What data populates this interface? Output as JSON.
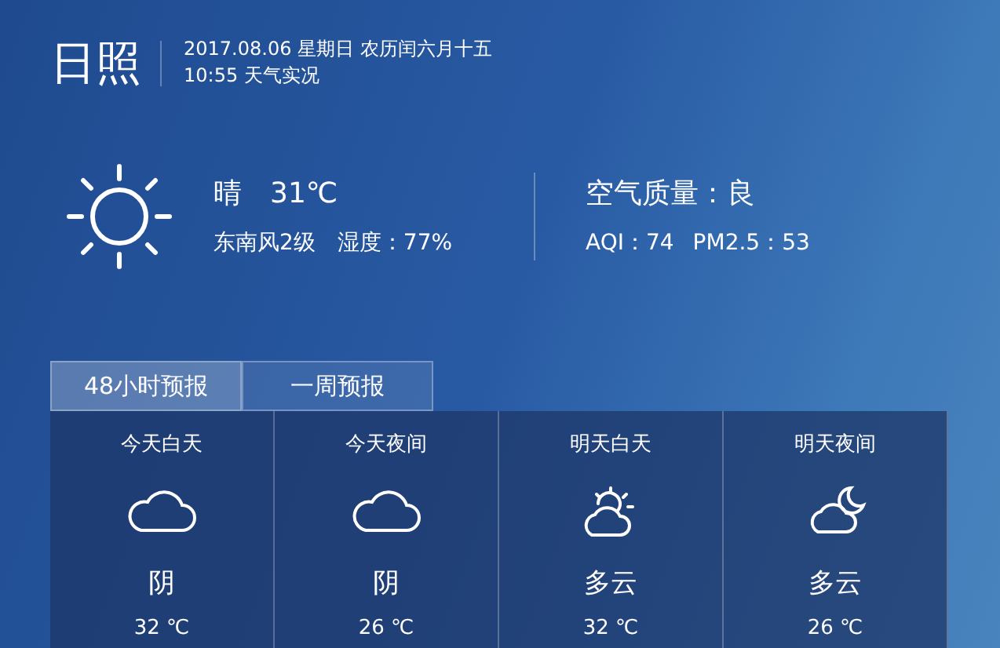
{
  "header": {
    "city": "日照",
    "date": "2017.08.06 星期日 农历闰六月十五",
    "time": "10:55 天气实况"
  },
  "current": {
    "kind": "sun",
    "condition": "晴",
    "temperature": "31℃",
    "wind": "东南风2级",
    "humidity": "湿度：77%",
    "air_quality": "空气质量：良",
    "aqi": "AQI：74",
    "pm25": "PM2.5：53"
  },
  "tabs": [
    {
      "label": "48小时预报",
      "selected": true
    },
    {
      "label": "一周预报",
      "selected": false
    }
  ],
  "forecast": [
    {
      "period": "今天白天",
      "kind": "cloud",
      "condition": "阴",
      "temperature": "32 ℃"
    },
    {
      "period": "今天夜间",
      "kind": "cloud",
      "condition": "阴",
      "temperature": "26 ℃"
    },
    {
      "period": "明天白天",
      "kind": "cloud-sun",
      "condition": "多云",
      "temperature": "32 ℃"
    },
    {
      "period": "明天夜间",
      "kind": "cloud-moon",
      "condition": "多云",
      "temperature": "26 ℃"
    }
  ]
}
